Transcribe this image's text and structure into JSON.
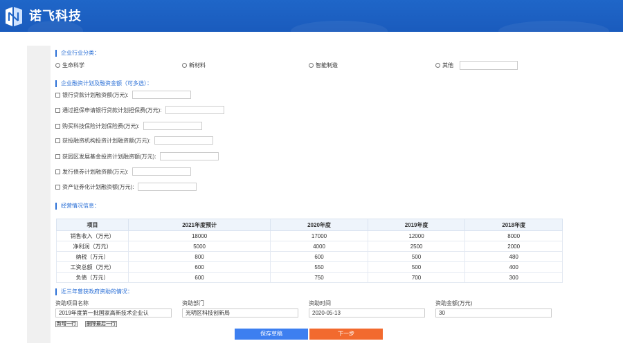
{
  "header": {
    "brand": "诺飞科技",
    "bg_color": "#1f66c8"
  },
  "industry": {
    "title": "企业行业分类：",
    "options": [
      "生命科学",
      "新材料",
      "智能制造",
      "其他"
    ],
    "other_value": ""
  },
  "financing": {
    "title": "企业融资计划及融资金额（可多选）：",
    "items": [
      {
        "label": "银行贷款计划融资额(万元):",
        "value": ""
      },
      {
        "label": "通过担保申请银行贷款计划担保费(万元):",
        "value": ""
      },
      {
        "label": "购买科技保险计划保险费(万元):",
        "value": ""
      },
      {
        "label": "获投融资机构投资计划融资额(万元):",
        "value": ""
      },
      {
        "label": "获园区发展基金投资计划融资额(万元):",
        "value": ""
      },
      {
        "label": "发行债券计划融资额(万元):",
        "value": ""
      },
      {
        "label": "资产证券化计划融资额(万元):",
        "value": ""
      }
    ]
  },
  "operations": {
    "title": "经营情况信息：",
    "headers": [
      "项目",
      "2021年度预计",
      "2020年度",
      "2019年度",
      "2018年度"
    ],
    "rows": [
      [
        "销售收入（万元）",
        "18000",
        "17000",
        "12000",
        "8000"
      ],
      [
        "净利润（万元）",
        "5000",
        "4000",
        "2500",
        "2000"
      ],
      [
        "纳税（万元）",
        "800",
        "600",
        "500",
        "480"
      ],
      [
        "工资总额（万元）",
        "600",
        "550",
        "500",
        "400"
      ],
      [
        "负债（万元）",
        "600",
        "750",
        "700",
        "300"
      ]
    ]
  },
  "funding": {
    "title": "近三年曾获政府资助的情况：",
    "headers": [
      "资助项目名称",
      "资助部门",
      "资助时间",
      "资助金额(万元)"
    ],
    "values": [
      "2019年度第一批国家高新技术企业认",
      "光明区科技创新局",
      "2020-05-13",
      "30"
    ],
    "add_row": "新增一行",
    "delete_row": "删除最后一行"
  },
  "actions": {
    "save": "保存草稿",
    "next": "下一步",
    "save_color": "#3d7ff0",
    "next_color": "#f26a2e"
  }
}
